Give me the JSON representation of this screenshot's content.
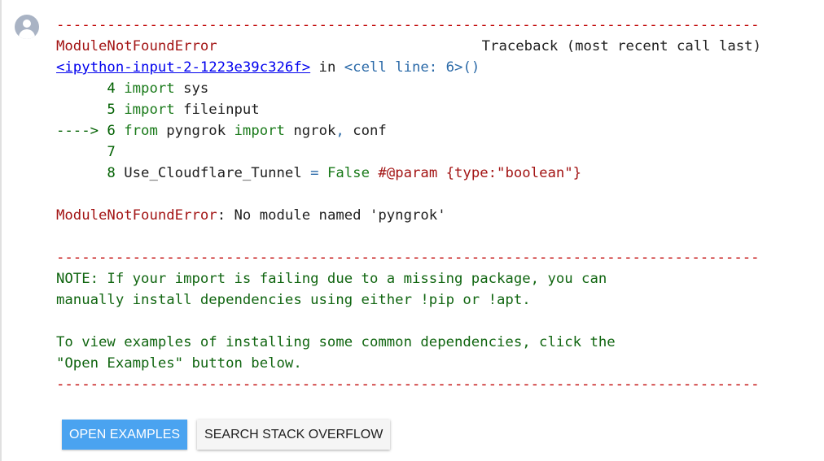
{
  "dash_line": "--------------------------------------------------------------------------------------------",
  "error": {
    "name": "ModuleNotFoundError",
    "traceback_label": "Traceback (most recent call last)",
    "input_link": "<ipython-input-2-1223e39c326f>",
    "in_text": " in ",
    "cell_line": "<cell line: 6>",
    "cell_paren": "()",
    "message_name": "ModuleNotFoundError",
    "message_text": ": No module named 'pyngrok'"
  },
  "code_lines": [
    {
      "prefix": "      4 ",
      "kw": "import",
      "rest": " sys"
    },
    {
      "prefix": "      5 ",
      "kw": "import",
      "rest": " fileinput"
    },
    {
      "arrow": "---->",
      "num": " 6 ",
      "kw1": "from",
      "mid": " pyngrok ",
      "kw2": "import",
      "rest": " ngrok",
      "comma": ",",
      "rest2": " conf"
    },
    {
      "prefix": "      7"
    },
    {
      "prefix": "      8 ",
      "var": "Use_Cloudflare_Tunnel ",
      "op": "=",
      "val": " False ",
      "comment": "#@param {type:\"boolean\"}"
    }
  ],
  "note": {
    "line1": "NOTE: If your import is failing due to a missing package, you can",
    "line2": "manually install dependencies using either !pip or !apt.",
    "line3": "To view examples of installing some common dependencies, click the",
    "line4": "\"Open Examples\" button below."
  },
  "buttons": {
    "open_examples": "OPEN EXAMPLES",
    "search_stack_overflow": "SEARCH STACK OVERFLOW"
  },
  "colors": {
    "error_red": "#a31515",
    "dash_red": "#c00000",
    "link_blue": "#0000ee",
    "note_green": "#116611",
    "primary_button": "#4aa3f0"
  }
}
